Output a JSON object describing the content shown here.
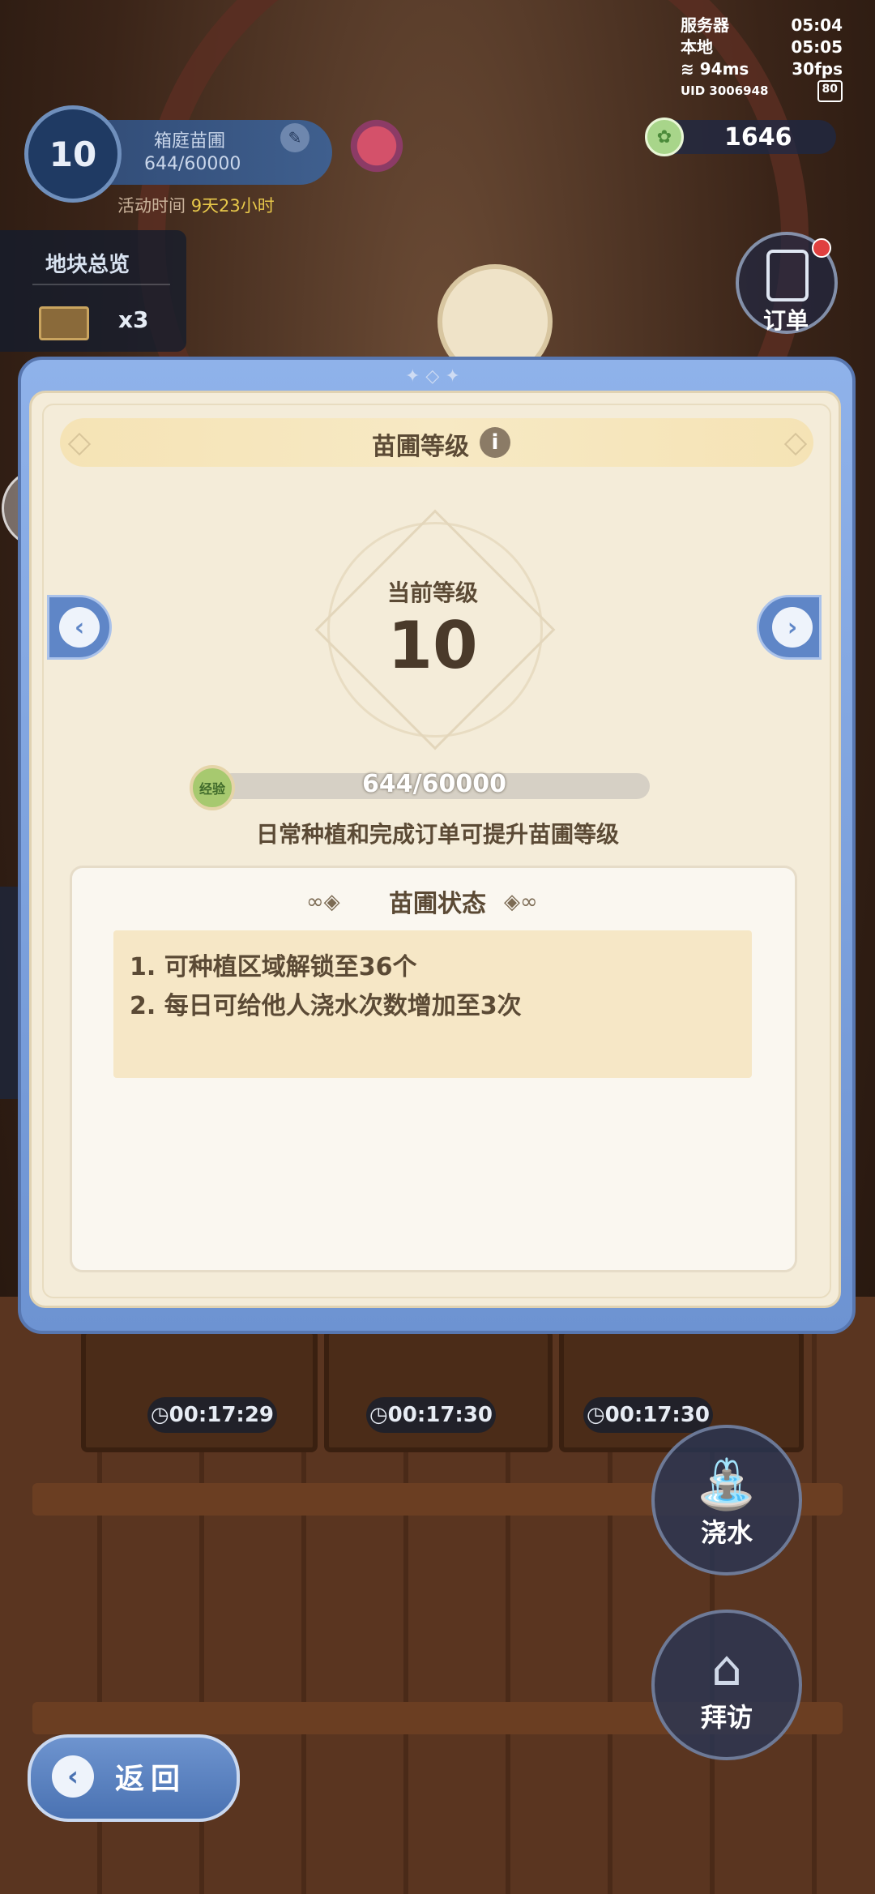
{
  "hud": {
    "server_label": "服务器",
    "server_time": "05:04",
    "local_label": "本地",
    "local_time": "05:05",
    "ping": "94ms",
    "fps": "30fps",
    "uid": "UID 3006948",
    "uid_badge": "80",
    "currency_value": "1646"
  },
  "garden": {
    "level": "10",
    "name": "箱庭苗圃",
    "exp": "644/60000",
    "event_label": "活动时间",
    "event_remaining": "9天23小时"
  },
  "plots": {
    "title": "地块总览",
    "count": "x3"
  },
  "order": {
    "label": "订单"
  },
  "modal": {
    "title": "苗圃等级",
    "current_level_label": "当前等级",
    "current_level": "10",
    "exp_badge": "经验",
    "exp_text": "644/60000",
    "exp_progress": 0.0107,
    "exp_hint": "日常种植和完成订单可提升苗圃等级",
    "status_title": "苗圃状态",
    "status_items": [
      "1.  可种植区域解锁至36个",
      "2.  每日可给他人浇水次数增加至3次"
    ]
  },
  "timers": [
    "00:17:29",
    "00:17:30",
    "00:17:30"
  ],
  "actions": {
    "water_label": "浇水",
    "visit_label": "拜访",
    "back_label": "返回"
  },
  "colors": {
    "frame_blue": "#6d93d2",
    "parchment": "#f4ecd9",
    "exp_green": "#9dbd6e"
  }
}
